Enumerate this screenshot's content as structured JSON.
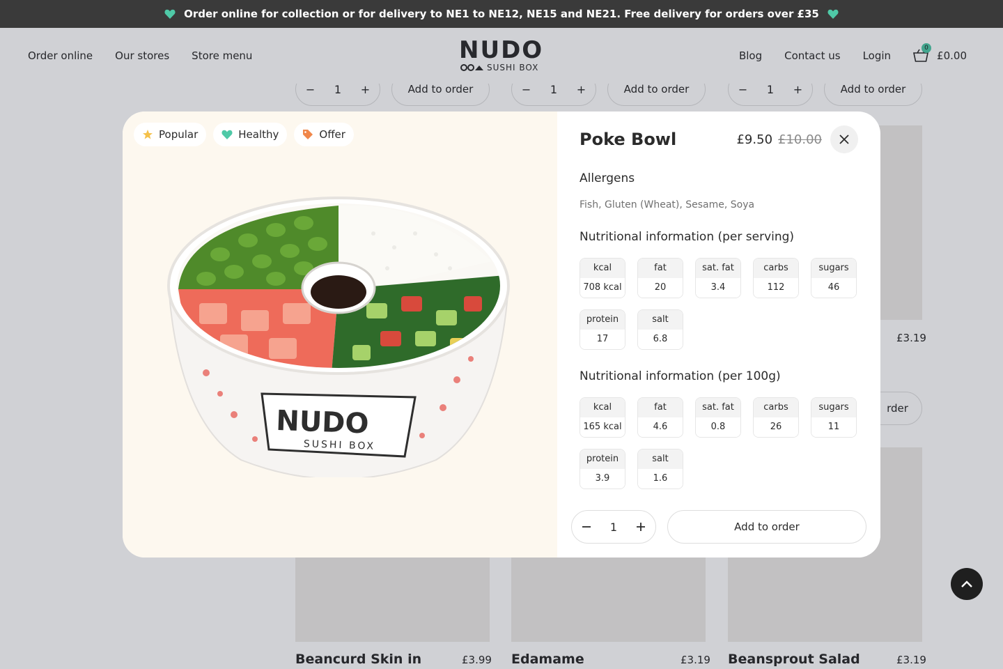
{
  "banner": {
    "text": "Order online for collection or for delivery to NE1 to NE12, NE15 and NE21. Free delivery for orders over £35",
    "accent": "#4fc9a7"
  },
  "nav": {
    "left": [
      "Order online",
      "Our stores",
      "Store menu"
    ],
    "right": [
      "Blog",
      "Contact us",
      "Login"
    ]
  },
  "logo": {
    "main": "NUDO",
    "sub": "SUSHI BOX"
  },
  "cart": {
    "count": "0",
    "total": "£0.00"
  },
  "background": {
    "qty_value": "1",
    "add_label": "Add to order",
    "partial_add_label": "rder",
    "partial_price": "£3.19",
    "cards": [
      {
        "title": "Beancurd Skin in",
        "price": "£3.99"
      },
      {
        "title": "Edamame",
        "price": "£3.19"
      },
      {
        "title": "Beansprout Salad",
        "price": "£3.19"
      }
    ]
  },
  "modal": {
    "tags": [
      {
        "label": "Popular",
        "icon": "star-icon",
        "color": "#f5c14a"
      },
      {
        "label": "Healthy",
        "icon": "heart-icon",
        "color": "#4fc9a7"
      },
      {
        "label": "Offer",
        "icon": "tag-icon",
        "color": "#f0874a"
      }
    ],
    "title": "Poke Bowl",
    "price": "£9.50",
    "was_price": "£10.00",
    "allergens_heading": "Allergens",
    "allergens": "Fish, Gluten (Wheat), Sesame, Soya",
    "serving_heading": "Nutritional information (per serving)",
    "serving": [
      {
        "k": "kcal",
        "v": "708 kcal"
      },
      {
        "k": "fat",
        "v": "20"
      },
      {
        "k": "sat. fat",
        "v": "3.4"
      },
      {
        "k": "carbs",
        "v": "112"
      },
      {
        "k": "sugars",
        "v": "46"
      },
      {
        "k": "protein",
        "v": "17"
      },
      {
        "k": "salt",
        "v": "6.8"
      }
    ],
    "per100_heading": "Nutritional information (per 100g)",
    "per100": [
      {
        "k": "kcal",
        "v": "165 kcal"
      },
      {
        "k": "fat",
        "v": "4.6"
      },
      {
        "k": "sat. fat",
        "v": "0.8"
      },
      {
        "k": "carbs",
        "v": "26"
      },
      {
        "k": "sugars",
        "v": "11"
      },
      {
        "k": "protein",
        "v": "3.9"
      },
      {
        "k": "salt",
        "v": "1.6"
      }
    ],
    "qty": "1",
    "add_label": "Add to order",
    "bowl_logo": "NUDO",
    "bowl_sub": "SUSHI BOX"
  }
}
